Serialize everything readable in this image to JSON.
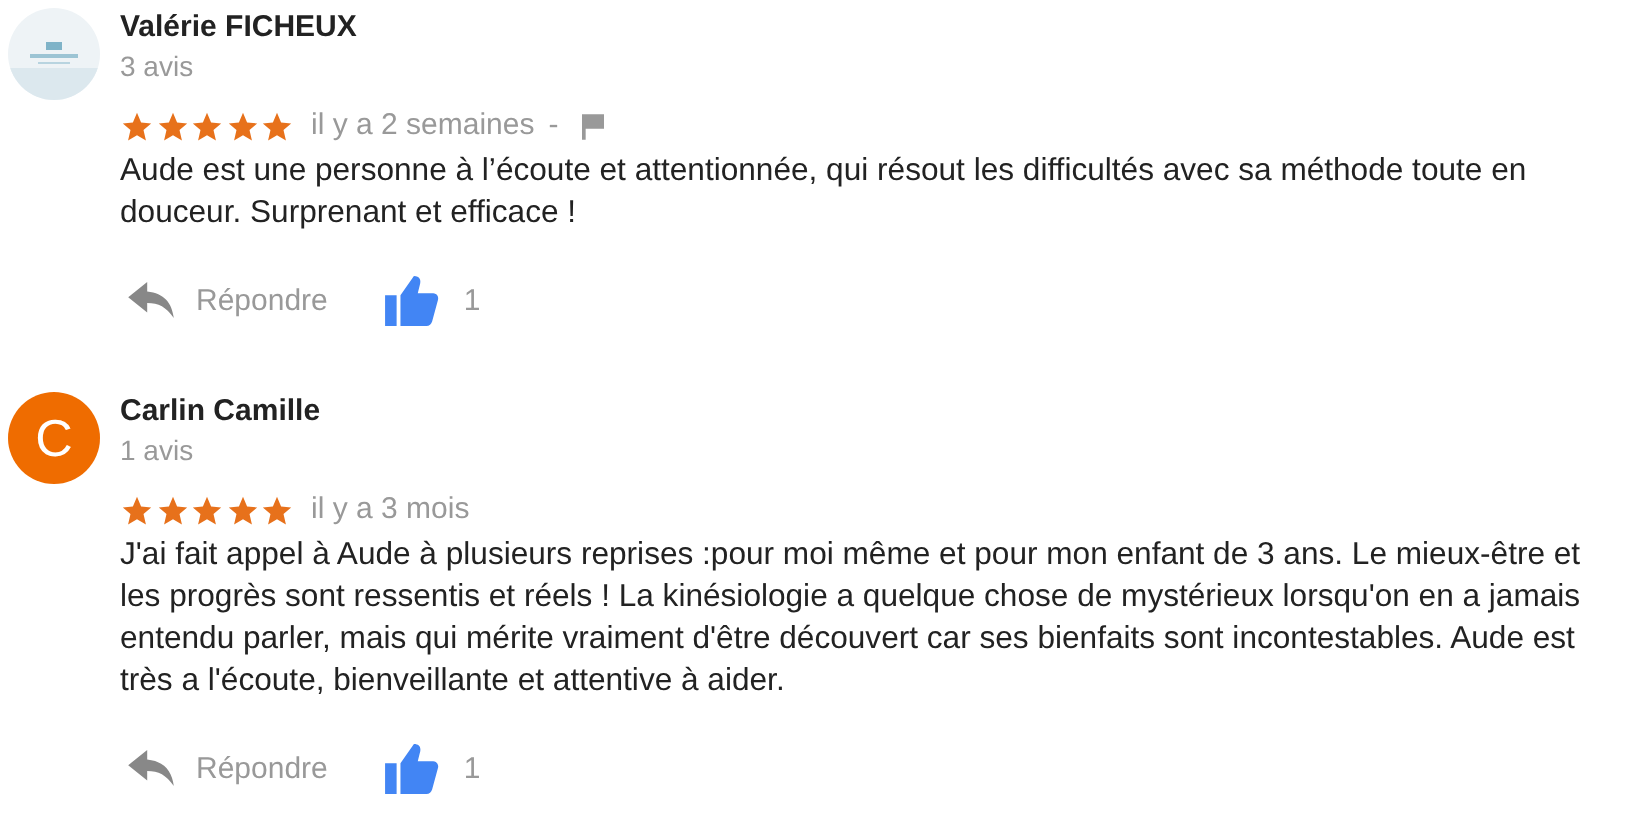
{
  "reviews": [
    {
      "author": "Valérie FICHEUX",
      "count": "3 avis",
      "stars": 5,
      "date": "il y a 2 semaines",
      "separator": "-",
      "flag": true,
      "text": "Aude est une personne à l’écoute et attentionnée, qui résout les difficultés avec sa méthode toute en douceur. Surprenant et efficace !",
      "reply": "Répondre",
      "likes": "1"
    },
    {
      "author": "Carlin Camille",
      "avatar": {
        "kind": "letter",
        "letter": "C",
        "color": "#ef6c00"
      },
      "count": "1 avis",
      "stars": 5,
      "date": "il y a 3 mois",
      "flag": false,
      "text": "J'ai fait appel à Aude à plusieurs reprises :pour moi même et pour mon enfant de 3 ans. Le mieux-être et les progrès sont ressentis et réels ! La kinésiologie a quelque chose de mystérieux lorsqu'on en a jamais entendu parler, mais qui mérite vraiment d'être découvert car ses bienfaits sont incontestables. Aude est très a l'écoute, bienveillante et attentive à aider.",
      "reply": "Répondre",
      "likes": "1"
    }
  ]
}
